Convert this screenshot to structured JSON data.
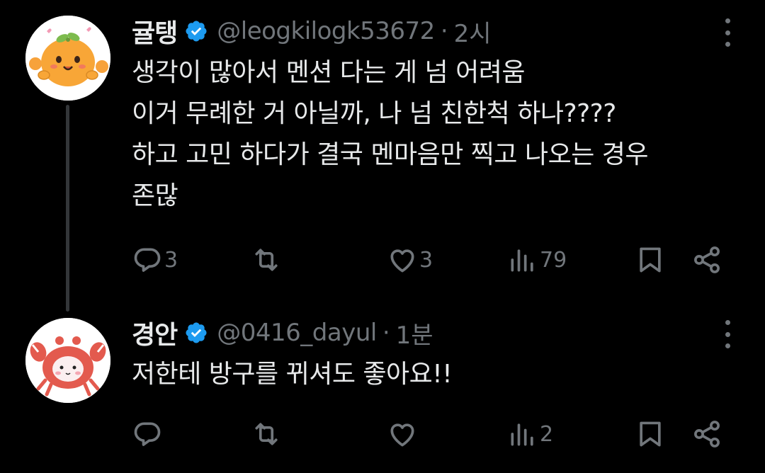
{
  "colors": {
    "background": "#000000",
    "primary_text": "#e7e9ea",
    "secondary_text": "#71767b",
    "verified_badge": "#1d9bf0",
    "thread_line": "#333639"
  },
  "tweets": [
    {
      "display_name": "귤탱",
      "handle": "@leogkilogk53672",
      "separator": "·",
      "time": "2시",
      "avatar_icon": "tangerine-character-avatar",
      "text_lines": [
        "생각이 많아서 멘션 다는 게 넘 어려움",
        "이거 무례한 거 아닐까, 나 넘 친한척 하나????",
        "하고 고민 하다가 결국 멘마음만 찍고 나오는 경우",
        "존많"
      ],
      "actions": {
        "reply_count": "3",
        "repost_count": "",
        "like_count": "3",
        "views_count": "79"
      }
    },
    {
      "display_name": "경안",
      "handle": "@0416_dayul",
      "separator": "·",
      "time": "1분",
      "avatar_icon": "crab-character-avatar",
      "text_lines": [
        "저한테 방구를 뀌셔도 좋아요!!"
      ],
      "actions": {
        "reply_count": "",
        "repost_count": "",
        "like_count": "",
        "views_count": "2"
      }
    }
  ]
}
